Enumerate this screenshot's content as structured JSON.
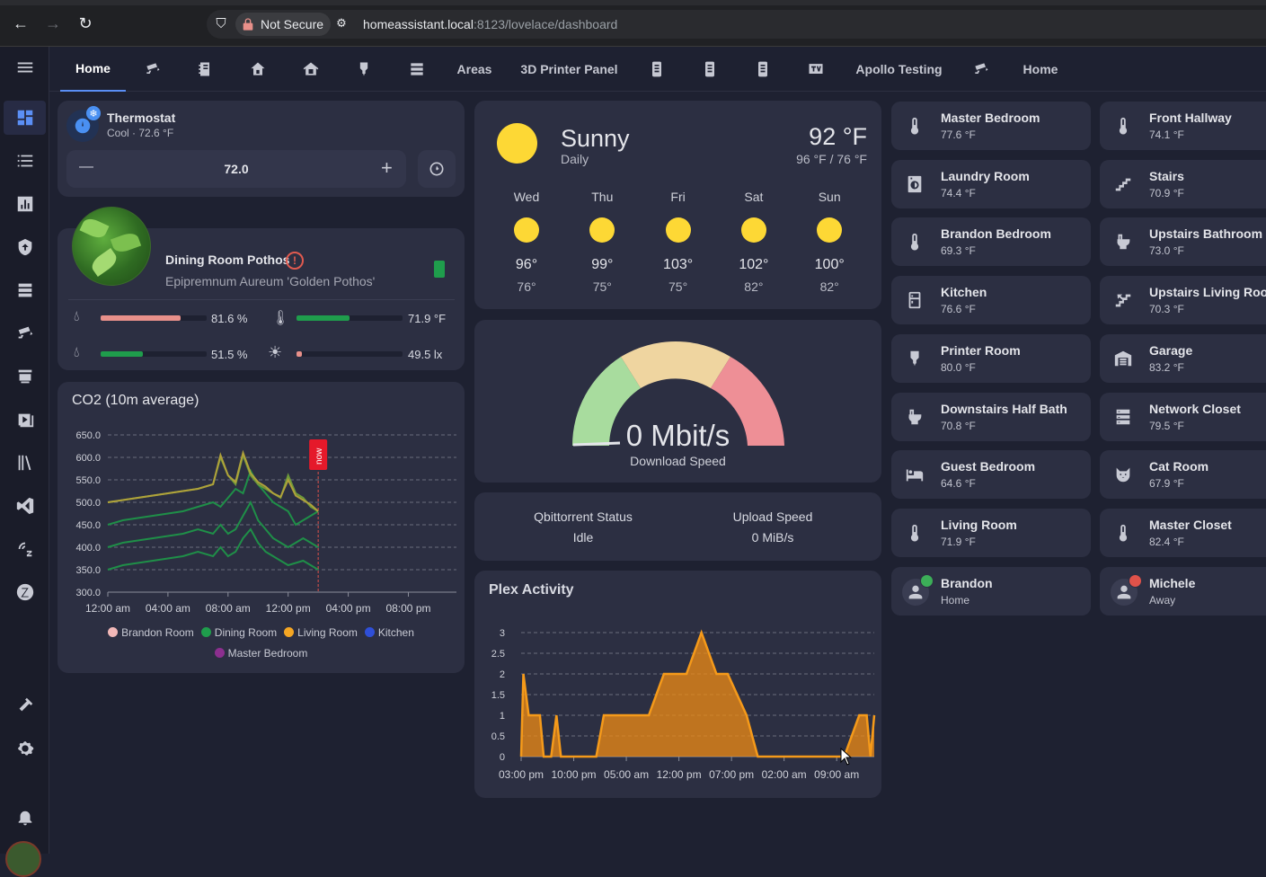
{
  "browser": {
    "not_secure_label": "Not Secure",
    "url_host": "homeassistant.local",
    "url_rest": ":8123/lovelace/dashboard"
  },
  "tabs": [
    {
      "label": "Home",
      "icon": "home-text"
    },
    {
      "label": "",
      "icon": "cctv-icon"
    },
    {
      "label": "",
      "icon": "notebook-icon"
    },
    {
      "label": "",
      "icon": "home-icon"
    },
    {
      "label": "",
      "icon": "home-roof-icon"
    },
    {
      "label": "",
      "icon": "printer-3d-icon"
    },
    {
      "label": "",
      "icon": "server-icon"
    },
    {
      "label": "Areas",
      "icon": ""
    },
    {
      "label": "3D Printer Panel",
      "icon": ""
    },
    {
      "label": "",
      "icon": "sensor-icon"
    },
    {
      "label": "",
      "icon": "sensor-icon"
    },
    {
      "label": "",
      "icon": "sensor-icon"
    },
    {
      "label": "",
      "icon": "tv-icon"
    },
    {
      "label": "Apollo Testing",
      "icon": ""
    },
    {
      "label": "",
      "icon": "cctv-icon"
    },
    {
      "label": "Home",
      "icon": ""
    }
  ],
  "thermostat": {
    "name": "Thermostat",
    "state": "Cool · 72.6 °F",
    "setpoint": "72.0",
    "minus": "—",
    "plus": "+"
  },
  "plant": {
    "name": "Dining Room Pothos",
    "species": "Epipremnum Aureum 'Golden Pothos'",
    "moisture": "81.6 %",
    "temperature": "71.9 °F",
    "conductivity": "51.5 %",
    "illuminance": "49.5 lx",
    "moisture_level": 0.75,
    "temperature_level": 0.5,
    "conductivity_level": 0.4,
    "illuminance_level": 0.05
  },
  "co2": {
    "title": "CO2 (10m average)",
    "now_label": "now",
    "legend": [
      "Brandon Room",
      "Dining Room",
      "Living Room",
      "Kitchen",
      "Master Bedroom"
    ],
    "legend_colors": [
      "#f2b8b8",
      "#1f9d4c",
      "#f5a623",
      "#2f4fd8",
      "#8c2f8f"
    ]
  },
  "weather": {
    "condition": "Sunny",
    "period": "Daily",
    "temp": "92 °F",
    "hilo": "96 °F / 76 °F",
    "forecast": [
      {
        "day": "Wed",
        "hi": "96°",
        "lo": "76°"
      },
      {
        "day": "Thu",
        "hi": "99°",
        "lo": "75°"
      },
      {
        "day": "Fri",
        "hi": "103°",
        "lo": "75°"
      },
      {
        "day": "Sat",
        "hi": "102°",
        "lo": "82°"
      },
      {
        "day": "Sun",
        "hi": "100°",
        "lo": "82°"
      }
    ]
  },
  "gauge": {
    "value": "0 Mbit/s",
    "label": "Download Speed",
    "level": 0
  },
  "qbit": {
    "status_label": "Qbittorrent Status",
    "status_value": "Idle",
    "upload_label": "Upload Speed",
    "upload_value": "0 MiB/s"
  },
  "tiles": [
    {
      "name": "Master Bedroom",
      "value": "77.6 °F",
      "icon": "thermometer-icon"
    },
    {
      "name": "Front Hallway",
      "value": "74.1 °F",
      "icon": "thermometer-icon"
    },
    {
      "name": "Laundry Room",
      "value": "74.4 °F",
      "icon": "washing-machine-icon"
    },
    {
      "name": "Stairs",
      "value": "70.9 °F",
      "icon": "stairs-icon"
    },
    {
      "name": "Brandon Bedroom",
      "value": "69.3 °F",
      "icon": "thermometer-icon"
    },
    {
      "name": "Upstairs Bathroom",
      "value": "73.0 °F",
      "icon": "toilet-icon"
    },
    {
      "name": "Kitchen",
      "value": "76.6 °F",
      "icon": "fridge-icon"
    },
    {
      "name": "Upstairs Living Room",
      "value": "70.3 °F",
      "icon": "stairs-up-icon"
    },
    {
      "name": "Printer Room",
      "value": "80.0 °F",
      "icon": "printer-3d-icon"
    },
    {
      "name": "Garage",
      "value": "83.2 °F",
      "icon": "garage-icon"
    },
    {
      "name": "Downstairs Half Bath",
      "value": "70.8 °F",
      "icon": "toilet-icon"
    },
    {
      "name": "Network Closet",
      "value": "79.5 °F",
      "icon": "server-icon"
    },
    {
      "name": "Guest Bedroom",
      "value": "64.6 °F",
      "icon": "bed-icon"
    },
    {
      "name": "Cat Room",
      "value": "67.9 °F",
      "icon": "cat-icon"
    },
    {
      "name": "Living Room",
      "value": "71.9 °F",
      "icon": "thermometer-icon"
    },
    {
      "name": "Master Closet",
      "value": "82.4 °F",
      "icon": "thermometer-icon"
    },
    {
      "name": "Brandon",
      "value": "Home",
      "icon": "account-icon"
    },
    {
      "name": "Michele",
      "value": "Away",
      "icon": "account-icon"
    }
  ],
  "plex": {
    "title": "Plex Activity"
  },
  "chart_data": [
    {
      "type": "line",
      "title": "CO2 (10m average)",
      "xlabel": "",
      "ylabel": "",
      "x_ticks": [
        "12:00 am",
        "04:00 am",
        "08:00 am",
        "12:00 pm",
        "04:00 pm",
        "08:00 pm"
      ],
      "y_ticks": [
        "300.0",
        "350.0",
        "400.0",
        "450.0",
        "500.0",
        "550.0",
        "600.0",
        "650.0"
      ],
      "ylim": [
        300,
        650
      ],
      "x_hours": [
        0,
        1,
        2,
        3,
        4,
        5,
        6,
        7,
        7.5,
        8,
        8.5,
        9,
        9.5,
        10,
        10.5,
        11,
        11.5,
        12,
        12.5,
        13,
        13.5,
        14
      ],
      "series": [
        {
          "name": "Brandon Room",
          "values": [
            500,
            505,
            510,
            515,
            520,
            525,
            530,
            540,
            600,
            560,
            540,
            605,
            560,
            540,
            530,
            520,
            510,
            560,
            520,
            510,
            490,
            480
          ]
        },
        {
          "name": "Dining Room",
          "values": [
            450,
            460,
            465,
            470,
            475,
            480,
            490,
            500,
            490,
            510,
            530,
            520,
            570,
            540,
            520,
            500,
            490,
            480,
            450,
            460,
            470,
            480
          ]
        },
        {
          "name": "Living Room",
          "values": [
            500,
            505,
            510,
            515,
            520,
            525,
            530,
            540,
            605,
            560,
            545,
            610,
            565,
            545,
            535,
            520,
            512,
            550,
            515,
            505,
            495,
            480
          ]
        },
        {
          "name": "Kitchen",
          "values": [
            400,
            410,
            415,
            420,
            425,
            430,
            440,
            430,
            450,
            430,
            440,
            470,
            500,
            460,
            440,
            420,
            410,
            400,
            410,
            420,
            410,
            400
          ]
        },
        {
          "name": "Master Bedroom",
          "values": [
            350,
            360,
            365,
            370,
            375,
            380,
            390,
            380,
            400,
            380,
            390,
            420,
            440,
            410,
            390,
            380,
            370,
            360,
            365,
            370,
            360,
            350
          ]
        }
      ]
    },
    {
      "type": "area",
      "title": "Plex Activity",
      "xlabel": "",
      "ylabel": "",
      "x_ticks": [
        "03:00 pm",
        "10:00 pm",
        "05:00 am",
        "12:00 pm",
        "07:00 pm",
        "02:00 am",
        "09:00 am"
      ],
      "y_ticks": [
        "0",
        "0.5",
        "1",
        "1.5",
        "2",
        "2.5",
        "3"
      ],
      "ylim": [
        0,
        3
      ],
      "x_hours": [
        0,
        0.3,
        1,
        2.5,
        3,
        4,
        4.7,
        5.3,
        6,
        9,
        10,
        11,
        17,
        19,
        19.5,
        22,
        24,
        26,
        27,
        27.5,
        30,
        31.5,
        32,
        36,
        38,
        38.5,
        43,
        45,
        46,
        46.5,
        47
      ],
      "values": [
        0,
        2,
        1,
        1,
        0,
        0,
        1,
        0,
        0,
        0,
        0,
        1,
        1,
        2,
        2,
        2,
        3,
        2,
        2,
        2,
        1,
        0,
        0,
        0,
        0,
        0,
        0,
        1,
        1,
        0,
        1
      ],
      "color": "#f08c14"
    }
  ]
}
